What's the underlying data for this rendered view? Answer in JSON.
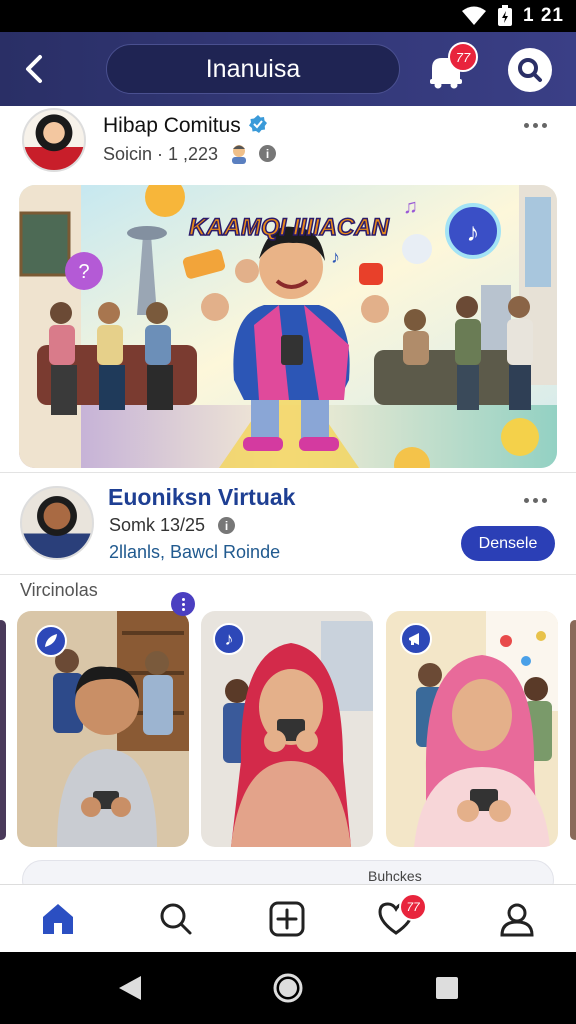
{
  "status_bar": {
    "time": "1 21"
  },
  "header": {
    "title": "Inanuisa",
    "notification_count": "77"
  },
  "post1": {
    "author": "Hibap Comitus",
    "subtitle": "Soicin · 1 ,223",
    "info_glyph": "i"
  },
  "hero": {
    "banner_text": "KAAMQI IIIIACAN"
  },
  "post2": {
    "author": "Euoniksn Virtuak",
    "subtitle": "Somk 13/25",
    "info_glyph": "i",
    "link": "2llanls, Bawcl Roinde",
    "action_label": "Densele"
  },
  "stories": {
    "title": "Vircinolas",
    "items": [
      {
        "badge_icon": "feather-icon"
      },
      {
        "badge_icon": "music-note-icon"
      },
      {
        "badge_icon": "megaphone-icon"
      }
    ]
  },
  "partial_row": {
    "label": "Buhckes"
  },
  "bottom_nav": {
    "notification_count": "77"
  },
  "colors": {
    "header": "#2a2f66",
    "accent": "#2b3fb6",
    "badge": "#e8243c",
    "link": "#1e3f93"
  }
}
